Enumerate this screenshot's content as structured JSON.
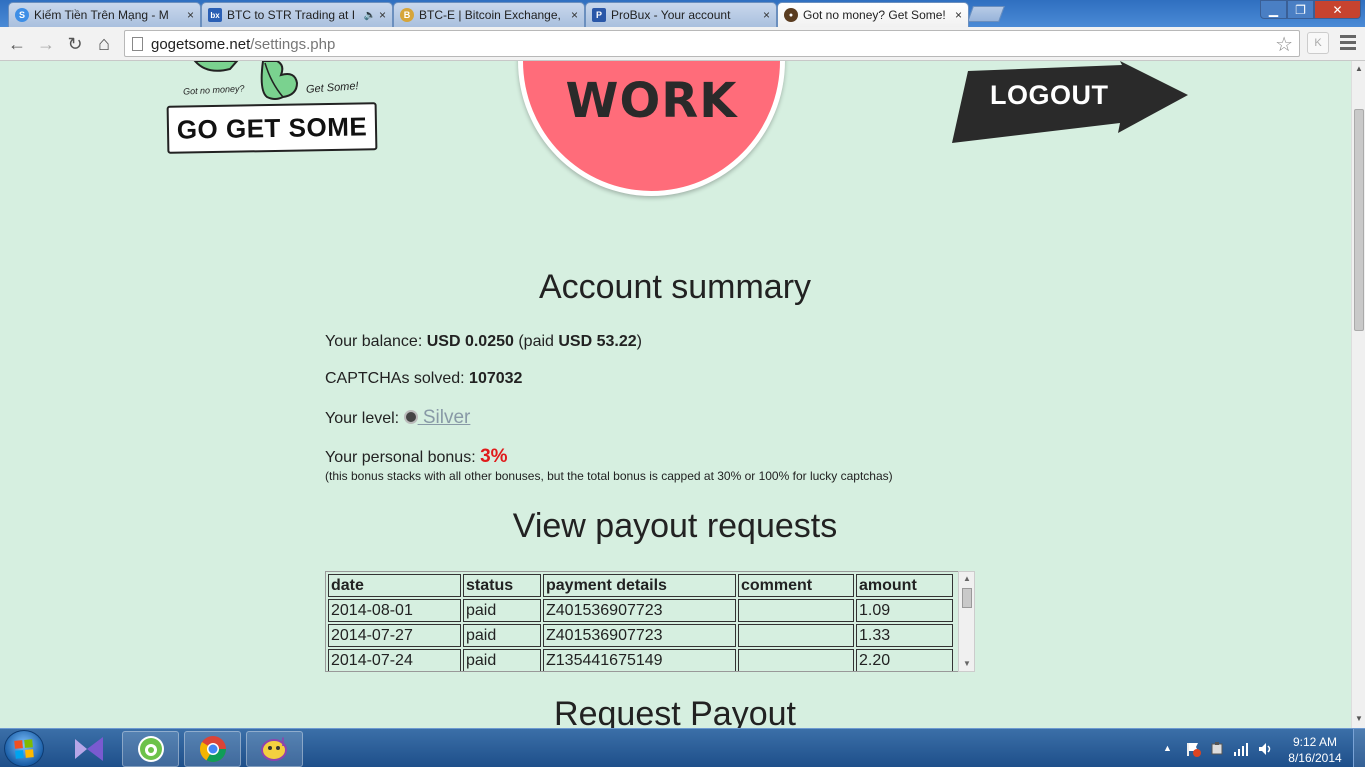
{
  "browser": {
    "tabs": [
      {
        "title": "Kiếm Tiền Trên Mạng - M",
        "icon": "s-site-icon",
        "color": "#3d8ee6",
        "glyph": "S"
      },
      {
        "title": "BTC to STR Trading at I",
        "icon": "bx-site-icon",
        "color": "#2a5fb5",
        "glyph": "bx",
        "audio": "🔈"
      },
      {
        "title": "BTC-E | Bitcoin Exchange,",
        "icon": "btce-coin-icon",
        "color": "#d6a53a",
        "glyph": "B"
      },
      {
        "title": "ProBux - Your account",
        "icon": "probux-icon",
        "color": "#2a57a8",
        "glyph": "P"
      },
      {
        "title": "Got no money? Get Some!",
        "icon": "gogetsome-icon",
        "color": "#5a3c20",
        "glyph": "●"
      }
    ],
    "close_glyph": "×",
    "window_controls": {
      "minimize": "▁",
      "maximize": "❐",
      "close": "✕"
    },
    "toolbar": {
      "back": "←",
      "forward": "→",
      "reload": "↻",
      "home": "⌂",
      "url_host": "gogetsome.net",
      "url_path": "/settings.php",
      "star": "☆",
      "extension": "K"
    }
  },
  "site": {
    "logo": {
      "tag_left": "Got no money?",
      "tag_right": "Get Some!",
      "name": "GO GET SOME"
    },
    "work_button": "WORK",
    "logout_button": "LOGOUT"
  },
  "account": {
    "heading": "Account summary",
    "balance_label": "Your balance:",
    "balance_value": "USD 0.0250",
    "paid_open": "(paid",
    "paid_value": "USD 53.22",
    "paid_close": ")",
    "captchas_label": "CAPTCHAs solved:",
    "captchas_value": "107032",
    "level_label": "Your level:",
    "level_value": " Silver",
    "bonus_label": "Your personal bonus:",
    "bonus_value": "3%",
    "bonus_note": "(this bonus stacks with all other bonuses, but the total bonus is capped at 30% or 100% for lucky captchas)"
  },
  "payouts": {
    "heading": "View payout requests",
    "columns": [
      "date",
      "status",
      "payment details",
      "comment",
      "amount"
    ],
    "rows": [
      [
        "2014-08-01",
        "paid",
        "Z401536907723",
        "",
        "1.09"
      ],
      [
        "2014-07-27",
        "paid",
        "Z401536907723",
        "",
        "1.33"
      ],
      [
        "2014-07-24",
        "paid",
        "Z135441675149",
        "",
        "2.20"
      ]
    ]
  },
  "request_payout": {
    "heading": "Request Payout"
  },
  "taskbar": {
    "apps": [
      "visual-studio-icon",
      "coccoc-browser-icon",
      "chrome-icon",
      "yahoo-messenger-icon"
    ],
    "tray_expand": "▲",
    "clock_time": "9:12 AM",
    "clock_date": "8/16/2014"
  }
}
